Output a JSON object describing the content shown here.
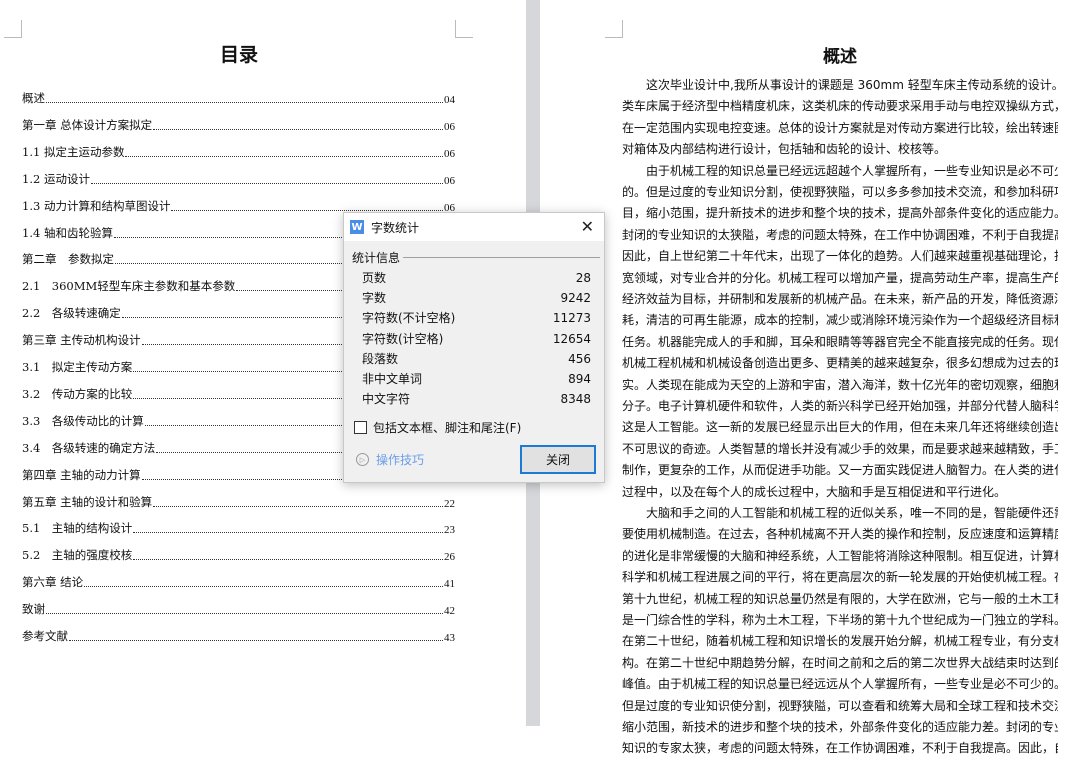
{
  "left_page": {
    "title": "目录",
    "toc": [
      {
        "label": "概述",
        "page": "04"
      },
      {
        "label": "第一章 总体设计方案拟定",
        "page": "06"
      },
      {
        "label": "1.1 拟定主运动参数",
        "page": "06"
      },
      {
        "label": "1.2 运动设计",
        "page": "06"
      },
      {
        "label": "1.3 动力计算和结构草图设计",
        "page": "06"
      },
      {
        "label": "1.4 轴和齿轮验算",
        "page": ""
      },
      {
        "label": "第二章　参数拟定",
        "page": ""
      },
      {
        "label": "2.1　360MM轻型车床主参数和基本参数",
        "page": ""
      },
      {
        "label": "2.2　各级转速确定",
        "page": ""
      },
      {
        "label": "第三章 主传动机构设计",
        "page": ""
      },
      {
        "label": "3.1　拟定主传动方案",
        "page": ""
      },
      {
        "label": "3.2　传动方案的比较",
        "page": ""
      },
      {
        "label": "3.3　各级传动比的计算",
        "page": ""
      },
      {
        "label": "3.4　各级转速的确定方法",
        "page": ""
      },
      {
        "label": "第四章 主轴的动力计算",
        "page": ""
      },
      {
        "label": "第五章 主轴的设计和验算",
        "page": "22"
      },
      {
        "label": "5.1　主轴的结构设计",
        "page": "23"
      },
      {
        "label": "5.2　主轴的强度校核",
        "page": "26"
      },
      {
        "label": "第六章 结论",
        "page": "41"
      },
      {
        "label": "致谢",
        "page": "42"
      },
      {
        "label": "参考文献",
        "page": "43"
      }
    ]
  },
  "right_page": {
    "title": "概述",
    "lines": [
      {
        "t": "这次毕业设计中,我所从事设计的课题是 360mm 轻型车床主传动系统的设计。此",
        "ind": 1
      },
      {
        "t": "类车床属于经济型中档精度机床，这类机床的传动要求采用手动与电控双操纵方式，"
      },
      {
        "t": "在一定范围内实现电控变速。总体的设计方案就是对传动方案进行比较，绘出转速图，"
      },
      {
        "t": "对箱体及内部结构进行设计，包括轴和齿轮的设计、校核等。",
        "last": 1
      },
      {
        "t": "由于机械工程的知识总量已经远远超越个人掌握所有，一些专业知识是必不可少",
        "ind": 1
      },
      {
        "t": "的。但是过度的专业知识分割，使视野狭隘，可以多多参加技术交流，和参加科研项"
      },
      {
        "t": "目，缩小范围，提升新技术的进步和整个块的技术，提高外部条件变化的适应能力。"
      },
      {
        "t": "封闭的专业知识的太狭隘，考虑的问题太特殊，在工作中协调困难，不利于自我提高。"
      },
      {
        "t": "因此，自上世纪第二十年代末，出现了一体化的趋势。人们越来越重视基础理论，拓"
      },
      {
        "t": "宽领域，对专业合并的分化。机械工程可以增加产量，提高劳动生产率，提高生产的"
      },
      {
        "t": "经济效益为目标，并研制和发展新的机械产品。在未来，新产品的开发，降低资源消"
      },
      {
        "t": "耗，清洁的可再生能源，成本的控制，减少或消除环境污染作为一个超级经济目标和"
      },
      {
        "t": "任务。机器能完成人的手和脚，耳朵和眼睛等等器官完全不能直接完成的任务。现代"
      },
      {
        "t": "机械工程机械和机械设备创造出更多、更精美的越来越复杂，很多幻想成为过去的现"
      },
      {
        "t": "实。人类现在能成为天空的上游和宇宙，潜入海洋，数十亿光年的密切观察，细胞和"
      },
      {
        "t": "分子。电子计算机硬件和软件，人类的新兴科学已经开始加强，并部分代替人脑科学，"
      },
      {
        "t": "这是人工智能。这一新的发展已经显示出巨大的作用，但在未来几年还将继续创造出"
      },
      {
        "t": "不可思议的奇迹。人类智慧的增长并没有减少手的效果，而是要求越来越精致，手工"
      },
      {
        "t": "制作，更复杂的工作，从而促进手功能。又一方面实践促进人脑智力。在人类的进化"
      },
      {
        "t": "过程中，以及在每个人的成长过程中，大脑和手是互相促进和平行进化。",
        "last": 1
      },
      {
        "t": "大脑和手之间的人工智能和机械工程的近似关系，唯一不同的是，智能硬件还需",
        "ind": 1
      },
      {
        "t": "要使用机械制造。在过去，各种机械离不开人类的操作和控制，反应速度和运算精度"
      },
      {
        "t": "的进化是非常缓慢的大脑和神经系统，人工智能将消除这种限制。相互促进，计算机"
      },
      {
        "t": "科学和机械工程进展之间的平行，将在更高层次的新一轮发展的开始使机械工程。在"
      },
      {
        "t": "第十九世纪，机械工程的知识总量仍然是有限的，大学在欧洲，它与一般的土木工程"
      },
      {
        "t": "是一门综合性的学科，称为土木工程，下半场的第十九个世纪成为一门独立的学科。"
      },
      {
        "t": "在第二十世纪，随着机械工程和知识增长的发展开始分解，机械工程专业，有分支机"
      },
      {
        "t": "构。在第二十世纪中期趋势分解，在时间之前和之后的第二次世界大战结束时达到的"
      },
      {
        "t": "峰值。由于机械工程的知识总量已经远远从个人掌握所有，一些专业是必不可少的。"
      },
      {
        "t": "但是过度的专业知识使分割，视野狭隘，可以查看和统筹大局和全球工程和技术交流，"
      },
      {
        "t": "缩小范围，新技术的进步和整个块的技术，外部条件变化的适应能力差。封闭的专业"
      },
      {
        "t": "知识的专家太狭，考虑的问题太特殊，在工作协调困难，不利于自我提高。因此，自"
      }
    ]
  },
  "dialog": {
    "title": "字数统计",
    "app_icon": "W",
    "section": "统计信息",
    "stats": [
      {
        "label": "页数",
        "value": "28"
      },
      {
        "label": "字数",
        "value": "9242"
      },
      {
        "label": "字符数(不计空格)",
        "value": "11273"
      },
      {
        "label": "字符数(计空格)",
        "value": "12654"
      },
      {
        "label": "段落数",
        "value": "456"
      },
      {
        "label": "非中文单词",
        "value": "894"
      },
      {
        "label": "中文字符",
        "value": "8348"
      }
    ],
    "checkbox_label": "包括文本框、脚注和尾注(F)",
    "checkbox_checked": false,
    "tips_label": "操作技巧",
    "close_button": "关闭",
    "close_icon": "✕"
  }
}
